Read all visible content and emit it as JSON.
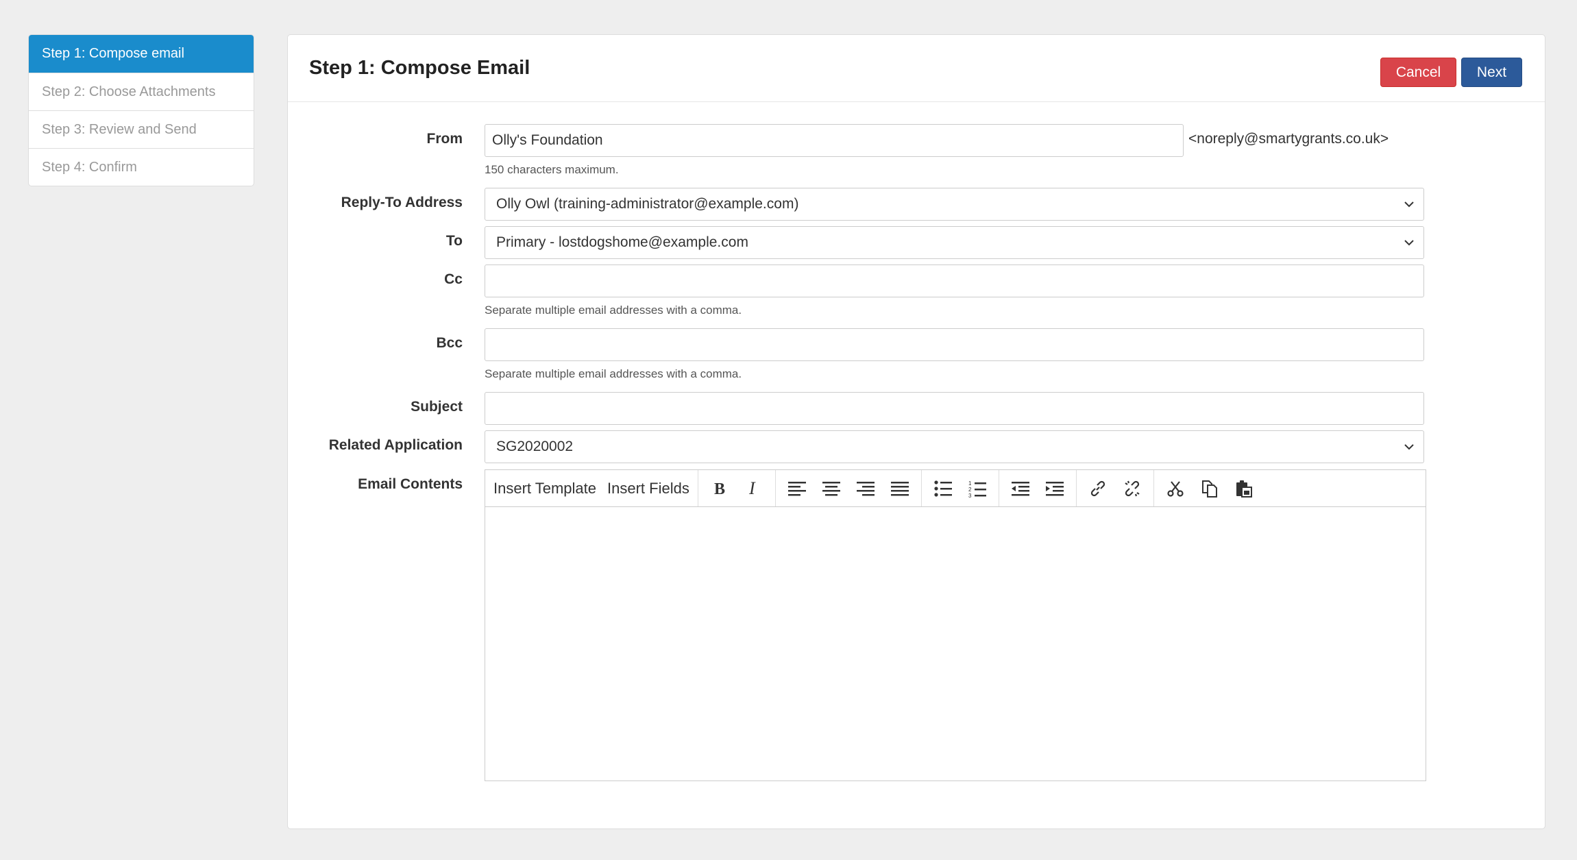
{
  "steps": [
    {
      "label": "Step 1: Compose email"
    },
    {
      "label": "Step 2: Choose Attachments"
    },
    {
      "label": "Step 3: Review and Send"
    },
    {
      "label": "Step 4: Confirm"
    }
  ],
  "panel": {
    "title": "Step 1: Compose Email",
    "cancel_label": "Cancel",
    "next_label": "Next"
  },
  "form": {
    "from_label": "From",
    "from_value": "Olly's Foundation",
    "from_suffix": "<noreply@smartygrants.co.uk>",
    "from_help": "150 characters maximum.",
    "reply_to_label": "Reply-To Address",
    "reply_to_value": "Olly Owl (training-administrator@example.com)",
    "to_label": "To",
    "to_value": "Primary - lostdogshome@example.com",
    "cc_label": "Cc",
    "cc_value": "",
    "cc_help": "Separate multiple email addresses with a comma.",
    "bcc_label": "Bcc",
    "bcc_value": "",
    "bcc_help": "Separate multiple email addresses with a comma.",
    "subject_label": "Subject",
    "subject_value": "",
    "related_label": "Related Application",
    "related_value": "SG2020002",
    "contents_label": "Email Contents"
  },
  "toolbar": {
    "insert_template": "Insert Template",
    "insert_fields": "Insert Fields",
    "icons": [
      "bold-icon",
      "italic-icon",
      "align-left-icon",
      "align-center-icon",
      "align-right-icon",
      "align-justify-icon",
      "bullet-list-icon",
      "numbered-list-icon",
      "outdent-icon",
      "indent-icon",
      "link-icon",
      "unlink-icon",
      "cut-icon",
      "copy-icon",
      "paste-icon"
    ]
  },
  "colors": {
    "active_step": "#1a8ccc",
    "cancel": "#d9444a",
    "next": "#2c5a9a"
  }
}
